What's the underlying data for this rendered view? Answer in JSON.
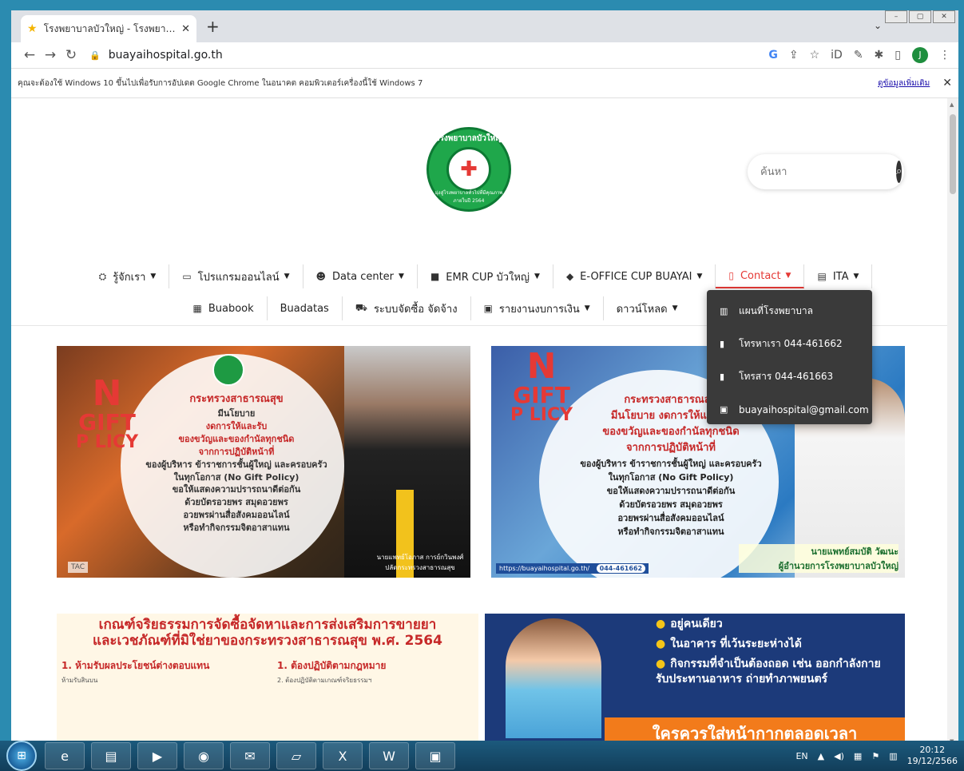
{
  "browser": {
    "tab_title": "โรงพยาบาลบัวใหญ่ - โรงพยาบาลทั่วไปขั้น...",
    "url": "buayaihospital.go.th",
    "profile_initial": "J",
    "infobar_message": "คุณจะต้องใช้ Windows 10 ขึ้นไปเพื่อรับการอัปเดต Google Chrome ในอนาคต คอมพิวเตอร์เครื่องนี้ใช้ Windows 7",
    "infobar_link": "ดูข้อมูลเพิ่มเติม"
  },
  "logo": {
    "top_text": "โรงพยาบาลบัวใหญ่",
    "bottom_text": "มุ่งสู่โรงพยาบาลทั่วไปที่มีคุณภาพ ภายในปี 2564"
  },
  "search": {
    "placeholder": "ค้นหา"
  },
  "nav": {
    "row1": [
      {
        "label": "รู้จักเรา",
        "icon": "people-icon"
      },
      {
        "label": "โปรแกรมออนไลน์",
        "icon": "window-icon"
      },
      {
        "label": "Data center",
        "icon": "users-icon"
      },
      {
        "label": "EMR CUP บัวใหญ่",
        "icon": "monitor-icon"
      },
      {
        "label": "E-OFFICE CUP BUAYAI",
        "icon": "folder-icon"
      },
      {
        "label": "Contact",
        "icon": "phone-icon"
      },
      {
        "label": "ITA",
        "icon": "list-icon"
      }
    ],
    "row2": [
      {
        "label": "Buabook",
        "icon": "book-icon"
      },
      {
        "label": "Buadatas",
        "icon": ""
      },
      {
        "label": "ระบบจัดซื้อ จัดจ้าง",
        "icon": "cart-icon"
      },
      {
        "label": "รายงานงบการเงิน",
        "icon": "document-icon"
      },
      {
        "label": "ดาวน์โหลด",
        "icon": ""
      }
    ]
  },
  "contact_dropdown": [
    {
      "label": "แผนที่โรงพยาบาล",
      "icon": "map-icon"
    },
    {
      "label": "โทรหาเรา 044-461662",
      "icon": "mobile-icon"
    },
    {
      "label": "โทรสาร 044-461663",
      "icon": "mobile-icon"
    },
    {
      "label": "buayaihospital@gmail.com",
      "icon": "email-icon"
    }
  ],
  "banners": {
    "b1": {
      "no": "N",
      "gift": "GIFT",
      "policy": "P LICY",
      "heading": "กระทรวงสาธารณสุข",
      "line1": "มีนโยบาย",
      "line2": "งดการให้และรับ",
      "line3": "ของขวัญและของกำนัลทุกชนิด",
      "line4": "จากการปฏิบัติหน้าที่",
      "line5": "ของผู้บริหาร ข้าราชการชั้นผู้ใหญ่ และครอบครัว",
      "line6": "ในทุกโอกาส (No Gift Policy)",
      "line7": "ขอให้แสดงความปรารถนาดีต่อกัน",
      "line8": "ด้วยบัตรอวยพร สมุดอวยพร",
      "line9": "อวยพรผ่านสื่อสังคมออนไลน์",
      "line10": "หรือทำกิจกรรมจิตอาสาแทน",
      "caption": "นายแพทย์โอภาส การย์กวินพงศ์ ปลัดกระทรวงสาธารณสุข",
      "footer": "TAC"
    },
    "b2": {
      "heading": "กระทรวงสาธารณสุข",
      "line1": "มีนโยบาย งดการให้และรับ",
      "line2": "ของขวัญและของกำนัลทุกชนิด",
      "line3": "จากการปฏิบัติหน้าที่",
      "line4": "ของผู้บริหาร ข้าราชการชั้นผู้ใหญ่ และครอบครัว",
      "line5": "ในทุกโอกาส (No Gift Policy)",
      "line6": "ขอให้แสดงความปรารถนาดีต่อกัน",
      "line7": "ด้วยบัตรอวยพร สมุดอวยพร",
      "line8": "อวยพรผ่านสื่อสังคมออนไลน์",
      "line9": "หรือทำกิจกรรมจิตอาสาแทน",
      "caption1": "นายแพทย์สมบัติ วัฒนะ",
      "caption2": "ผู้อำนวยการโรงพยาบาลบัวใหญ่",
      "footer": "https://buayaihospital.go.th/",
      "phone": "044-461662"
    },
    "b3": {
      "title1": "เกณฑ์จริยธรรมการจัดซื้อจัดหาและการส่งเสริมการขายยา",
      "title2": "และเวชภัณฑ์ที่มิใช่ยาของกระทรวงสาธารณสุข พ.ศ. 2564",
      "col1_title": "1. ห้ามรับผลประโยชน์ต่างตอบแทน",
      "col1_sub": "ห้ามรับสินบน",
      "col2_title": "1. ต้องปฏิบัติตามกฎหมาย",
      "col2_sub": "2. ต้องปฏิบัติตามเกณฑ์จริยธรรมฯ"
    },
    "b4": {
      "item1": "อยู่คนเดียว",
      "item2": "ในอาคาร ที่เว้นระยะห่างได้",
      "item3": "กิจกรรมที่จำเป็นต้องถอด เช่น ออกกำลังกาย รับประทานอาหาร ถ่ายทำภาพยนตร์",
      "bottom": "ใครควรใส่หน้ากากตลอดเวลา"
    }
  },
  "taskbar": {
    "lang": "EN",
    "time": "20:12",
    "date": "19/12/2566"
  }
}
